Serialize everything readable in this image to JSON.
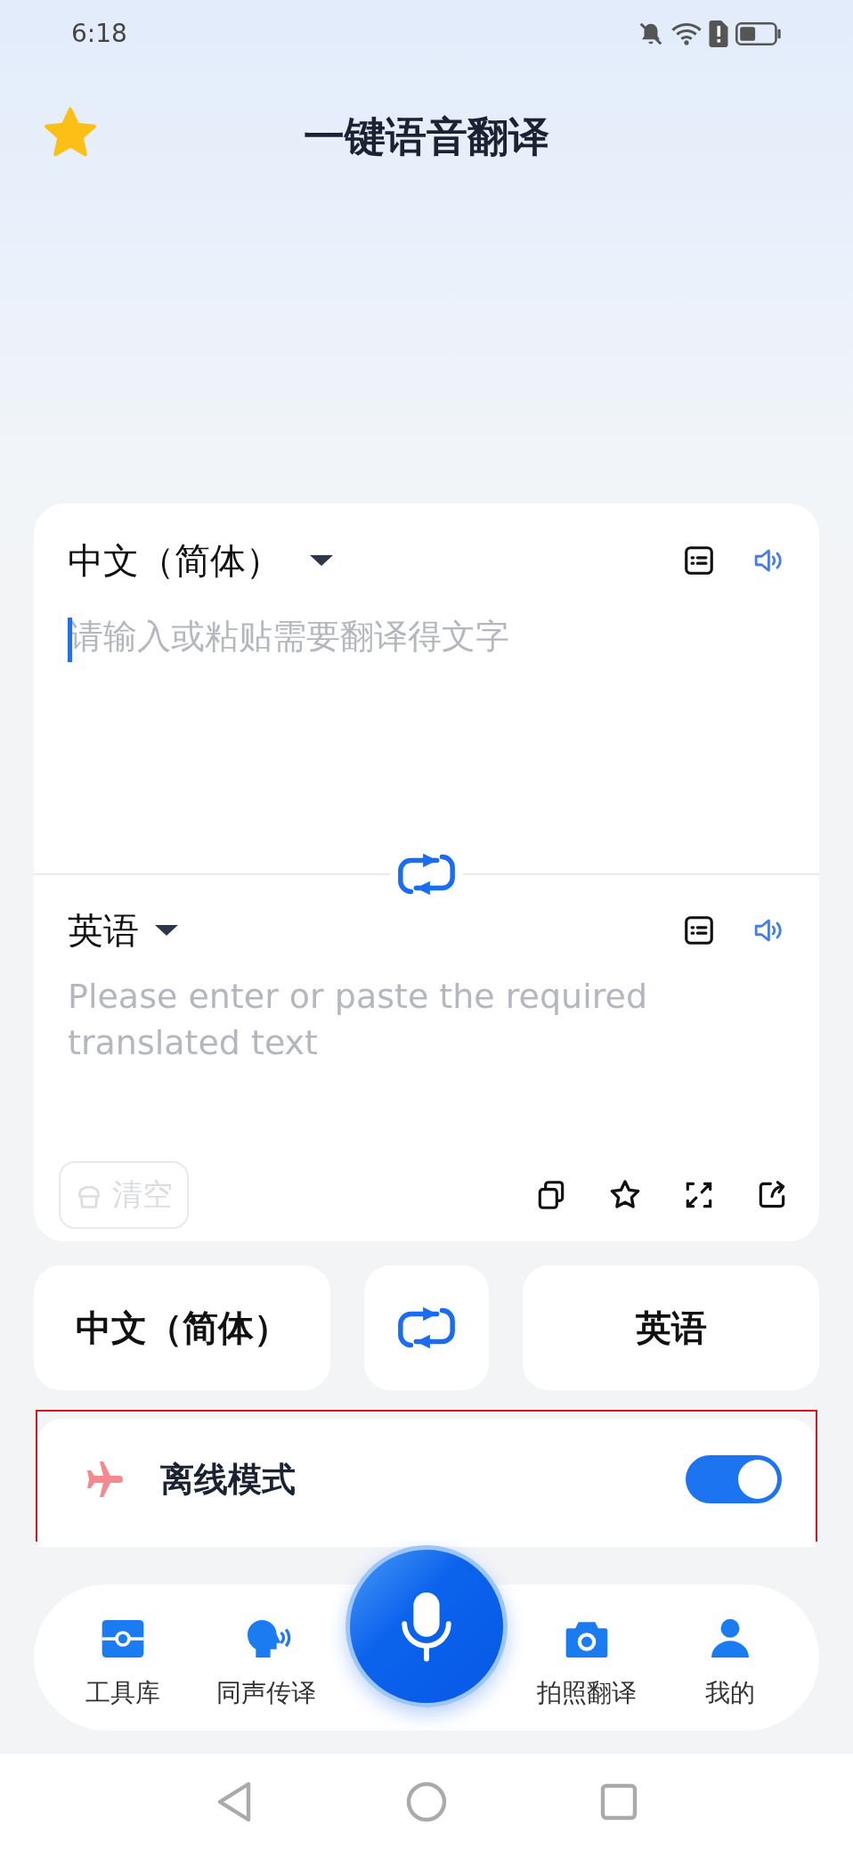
{
  "status_bar": {
    "time": "6:18"
  },
  "header": {
    "title": "一键语音翻译"
  },
  "source": {
    "language": "中文（简体）",
    "placeholder": "请输入或粘贴需要翻译得文字"
  },
  "target": {
    "language": "英语",
    "placeholder": "Please enter or paste the required translated text"
  },
  "clear_button": {
    "label": "清空",
    "disabled": true
  },
  "language_bar": {
    "from": "中文（简体）",
    "to": "英语"
  },
  "offline_mode": {
    "label": "离线模式",
    "on": true,
    "highlighted": true
  },
  "bottom_nav": [
    {
      "label": "工具库"
    },
    {
      "label": "同声传译"
    },
    {
      "label": "拍照翻译"
    },
    {
      "label": "我的"
    }
  ]
}
